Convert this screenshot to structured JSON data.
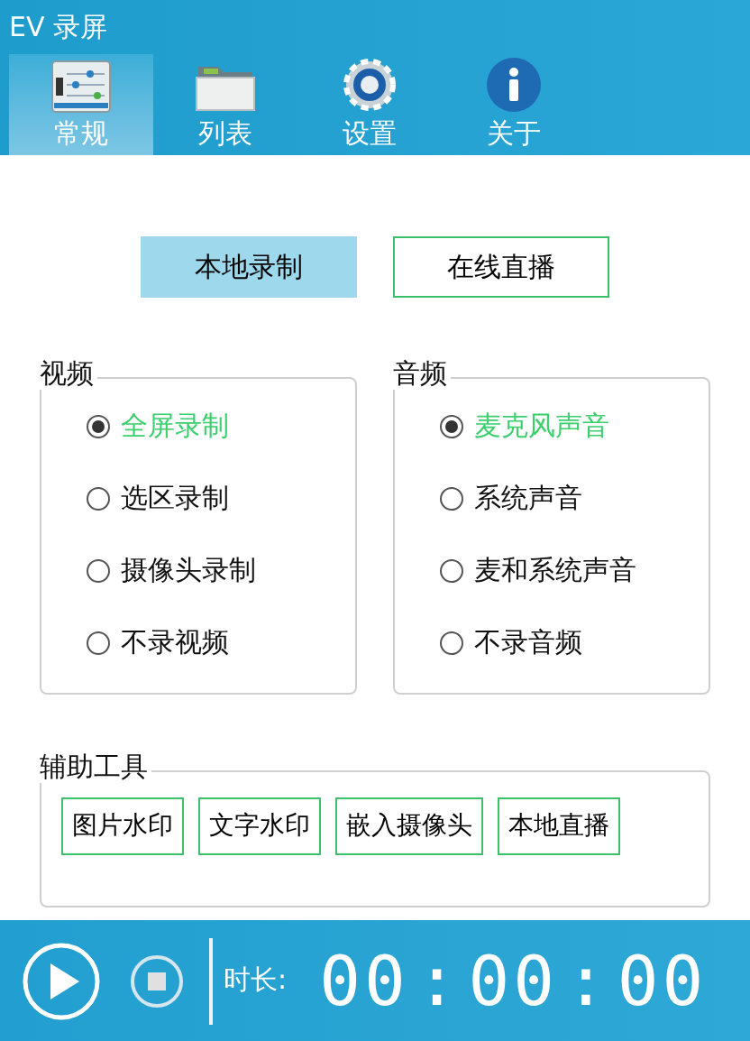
{
  "window": {
    "title": "EV 录屏"
  },
  "tabs": [
    {
      "label": "常规",
      "kind": "general",
      "selected": true
    },
    {
      "label": "列表",
      "kind": "list",
      "selected": false
    },
    {
      "label": "设置",
      "kind": "settings",
      "selected": false
    },
    {
      "label": "关于",
      "kind": "about",
      "selected": false
    }
  ],
  "modes": [
    {
      "label": "本地录制",
      "selected": true
    },
    {
      "label": "在线直播",
      "selected": false
    }
  ],
  "video": {
    "title": "视频",
    "options": [
      {
        "label": "全屏录制",
        "selected": true
      },
      {
        "label": "选区录制",
        "selected": false
      },
      {
        "label": "摄像头录制",
        "selected": false
      },
      {
        "label": "不录视频",
        "selected": false
      }
    ]
  },
  "audio": {
    "title": "音频",
    "options": [
      {
        "label": "麦克风声音",
        "selected": true
      },
      {
        "label": "系统声音",
        "selected": false
      },
      {
        "label": "麦和系统声音",
        "selected": false
      },
      {
        "label": "不录音频",
        "selected": false
      }
    ]
  },
  "tools": {
    "title": "辅助工具",
    "buttons": [
      "图片水印",
      "文字水印",
      "嵌入摄像头",
      "本地直播"
    ]
  },
  "status_bar": {
    "duration_label": "时长:",
    "timer": [
      "00",
      ":",
      "00",
      ":",
      "00"
    ]
  }
}
